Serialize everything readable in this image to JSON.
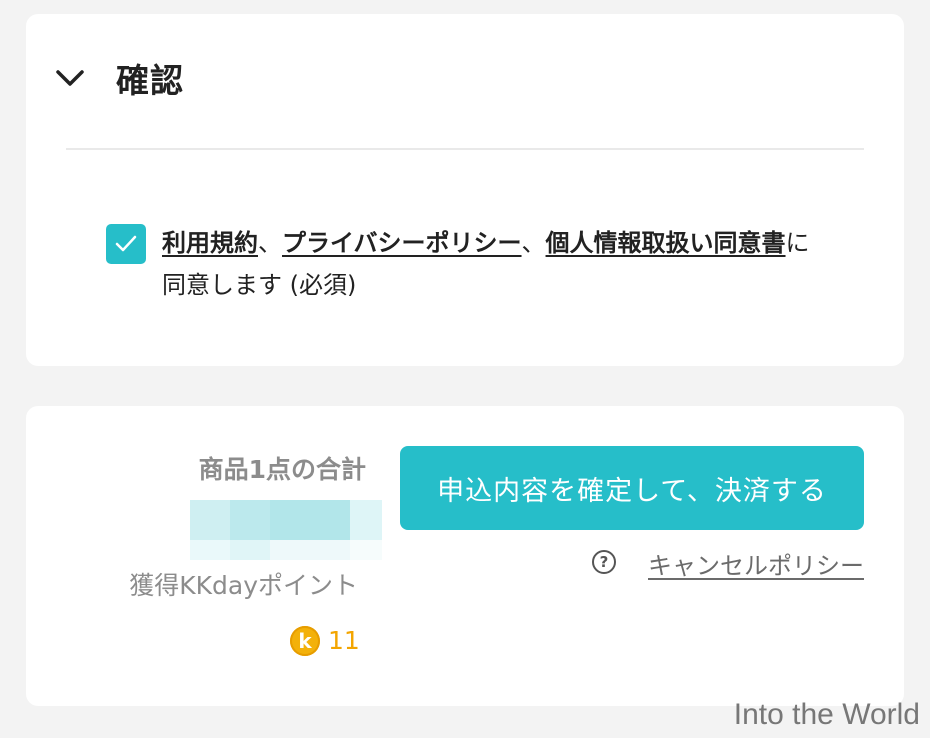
{
  "confirm_section": {
    "title": "確認",
    "icons": {
      "toggle": "chevron-down-icon",
      "checkbox": "checkmark-icon"
    },
    "agreement": {
      "checked": true,
      "terms_link": "利用規約",
      "sep1": "、",
      "privacy_link": "プライバシーポリシー",
      "sep2": "、",
      "personal_info_link": "個人情報取扱い同意書",
      "suffix": "に同意します (必須)"
    }
  },
  "payment_section": {
    "total_label": "商品1点の合計",
    "points_label": "獲得KKdayポイント",
    "points_coin_glyph": "k",
    "points_value": "11",
    "confirm_button": "申込内容を確定して、決済する",
    "cancel_policy_link": "キャンセルポリシー",
    "help_glyph": "?",
    "icons": {
      "coin": "kkday-coin-icon",
      "help": "question-circle-icon"
    }
  },
  "colors": {
    "accent": "#26bec9",
    "coin": "#f3b10a",
    "muted_text": "#8c8c8c",
    "background": "#f3f3f3"
  },
  "watermark": "Into the World"
}
